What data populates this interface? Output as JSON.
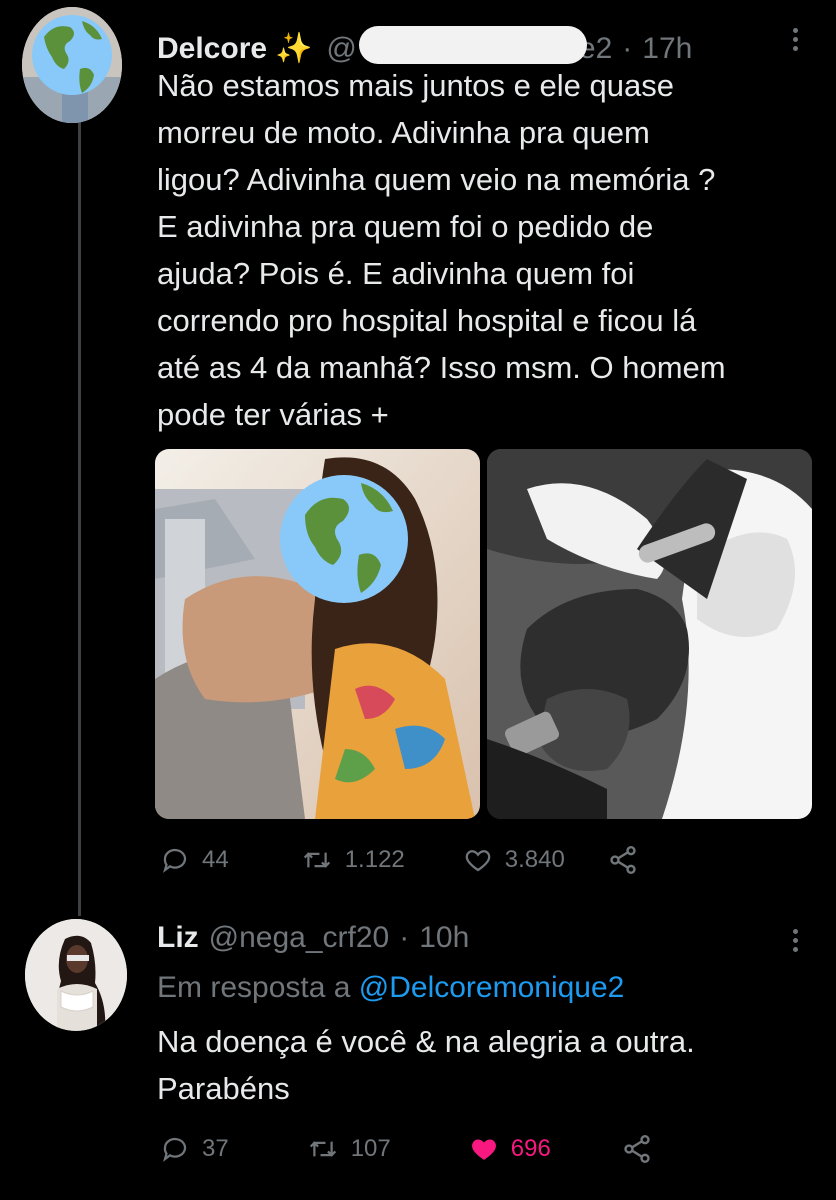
{
  "tweet": {
    "name": "Delcore",
    "badge": "✨",
    "handle_start": "@",
    "handle_end": "e2",
    "separator": "·",
    "time": "17h",
    "text": "Não estamos  mais juntos e ele quase\nmorreu de moto. Adivinha pra quem\nligou? Adivinha quem veio na memória ?\nE adivinha pra quem foi o pedido de\najuda? Pois é. E adivinha quem foi\ncorrendo pro hospital hospital e ficou lá\naté as 4 da manhã? Isso msm. O homem\npode ter várias  +",
    "replies": "44",
    "retweets": "1.122",
    "likes": "3.840",
    "icons": [
      "globe-avatar-icon",
      "sparkles-icon",
      "more-icon",
      "reply-icon",
      "retweet-icon",
      "like-icon",
      "share-icon"
    ]
  },
  "reply": {
    "name": "Liz",
    "handle": "@nega_crf20",
    "separator": "·",
    "time": "10h",
    "replying_label": "Em resposta a",
    "replying_handle": "@Delcoremonique2",
    "text": "Na doença é você & na alegria a outra.\nParabéns",
    "replies": "37",
    "retweets": "107",
    "likes": "696",
    "liked": true
  },
  "colors": {
    "background": "#000000",
    "text": "#e7e9ea",
    "muted": "#71767b",
    "link": "#1d9bf0",
    "like_active": "#f91880",
    "thread_line": "#3e4144"
  }
}
